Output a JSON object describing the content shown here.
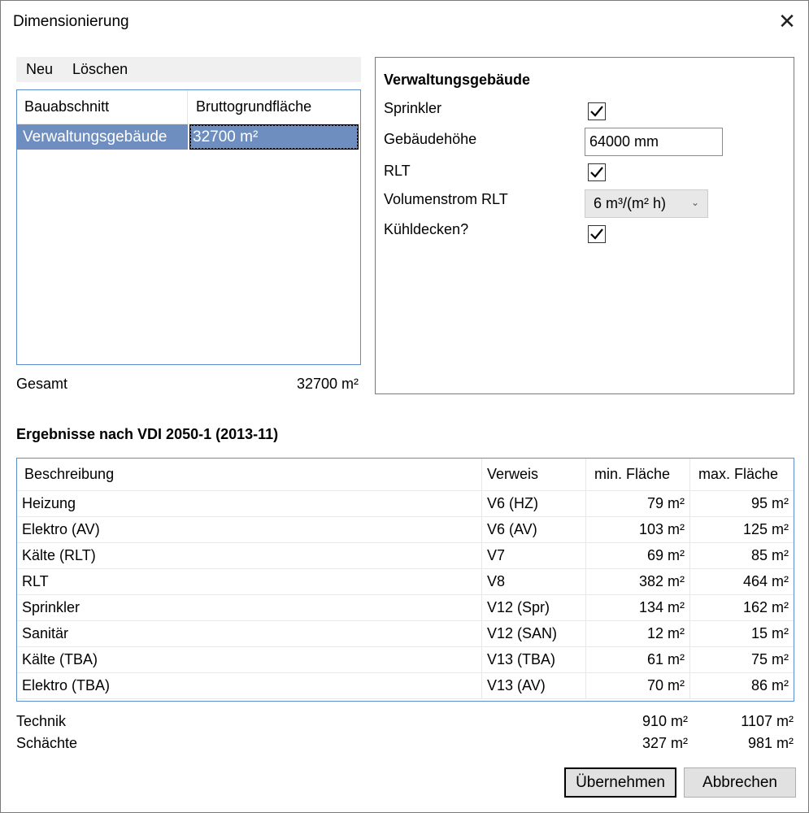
{
  "window": {
    "title": "Dimensionierung",
    "close_glyph": "✕"
  },
  "menu": {
    "items": [
      "Neu",
      "Löschen"
    ]
  },
  "list": {
    "columns": [
      "Bauabschnitt",
      "Bruttogrundfläche"
    ],
    "rows": [
      {
        "name": "Verwaltungsgebäude",
        "area": "32700 m²"
      }
    ],
    "total_label": "Gesamt",
    "total_value": "32700 m²"
  },
  "panel": {
    "title": "Verwaltungsgebäude",
    "sprinkler_label": "Sprinkler",
    "sprinkler_checked": true,
    "height_label": "Gebäudehöhe",
    "height_value": "64000 mm",
    "rlt_label": "RLT",
    "rlt_checked": true,
    "volume_label": "Volumenstrom RLT",
    "volume_value": "6 m³/(m² h)",
    "cooling_label": "Kühldecken?",
    "cooling_checked": true
  },
  "results": {
    "title": "Ergebnisse nach VDI 2050-1 (2013-11)",
    "columns": [
      "Beschreibung",
      "Verweis",
      "min. Fläche",
      "max. Fläche"
    ],
    "rows": [
      {
        "desc": "Heizung",
        "ref": "V6 (HZ)",
        "min": "79 m²",
        "max": "95 m²"
      },
      {
        "desc": "Elektro (AV)",
        "ref": "V6 (AV)",
        "min": "103 m²",
        "max": "125 m²"
      },
      {
        "desc": "Kälte (RLT)",
        "ref": "V7",
        "min": "69 m²",
        "max": "85 m²"
      },
      {
        "desc": "RLT",
        "ref": "V8",
        "min": "382 m²",
        "max": "464 m²"
      },
      {
        "desc": "Sprinkler",
        "ref": "V12 (Spr)",
        "min": "134 m²",
        "max": "162 m²"
      },
      {
        "desc": "Sanitär",
        "ref": "V12 (SAN)",
        "min": "12 m²",
        "max": "15 m²"
      },
      {
        "desc": "Kälte (TBA)",
        "ref": "V13 (TBA)",
        "min": "61 m²",
        "max": "75 m²"
      },
      {
        "desc": "Elektro (TBA)",
        "ref": "V13 (AV)",
        "min": "70 m²",
        "max": "86 m²"
      }
    ],
    "technik_label": "Technik",
    "technik_min": "910 m²",
    "technik_max": "1107 m²",
    "schaechte_label": "Schächte",
    "schaechte_min": "327 m²",
    "schaechte_max": "981 m²"
  },
  "buttons": {
    "apply": "Übernehmen",
    "cancel": "Abbrechen"
  }
}
